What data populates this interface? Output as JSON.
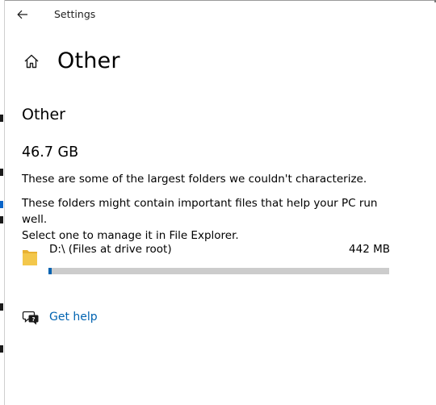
{
  "window": {
    "app_title": "Settings"
  },
  "header": {
    "page_title": "Other"
  },
  "section": {
    "heading": "Other",
    "size_total": "46.7 GB",
    "description_1": "These are some of the largest folders we couldn't characterize.",
    "description_2_line1": "These folders might contain important files that help your PC run well.",
    "description_2_line2": "Select one to manage it in File Explorer."
  },
  "folders": [
    {
      "name": "D:\\ (Files at drive root)",
      "size": "442 MB",
      "usage_fraction": 0.009,
      "icon": "folder-icon"
    }
  ],
  "help": {
    "label": "Get help",
    "icon": "chat-help-icon"
  },
  "icons": {
    "back": "back-arrow-icon",
    "home": "home-icon"
  },
  "colors": {
    "accent": "#0063b1",
    "track": "#cccccc",
    "folder": "#f3c74b"
  }
}
